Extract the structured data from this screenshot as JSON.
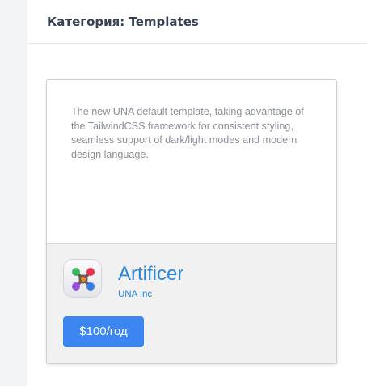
{
  "header": {
    "title": "Категория: Templates"
  },
  "product": {
    "description": "The new UNA default template, taking advantage of the TailwindCSS framework for consistent styling, seamless support of dark/light modes and modern design language.",
    "name": "Artificer",
    "vendor": "UNA Inc",
    "price_label": "$100/год",
    "icon": "artificer-app-icon"
  },
  "colors": {
    "accent": "#2b86d9",
    "button": "#3b86f0"
  }
}
